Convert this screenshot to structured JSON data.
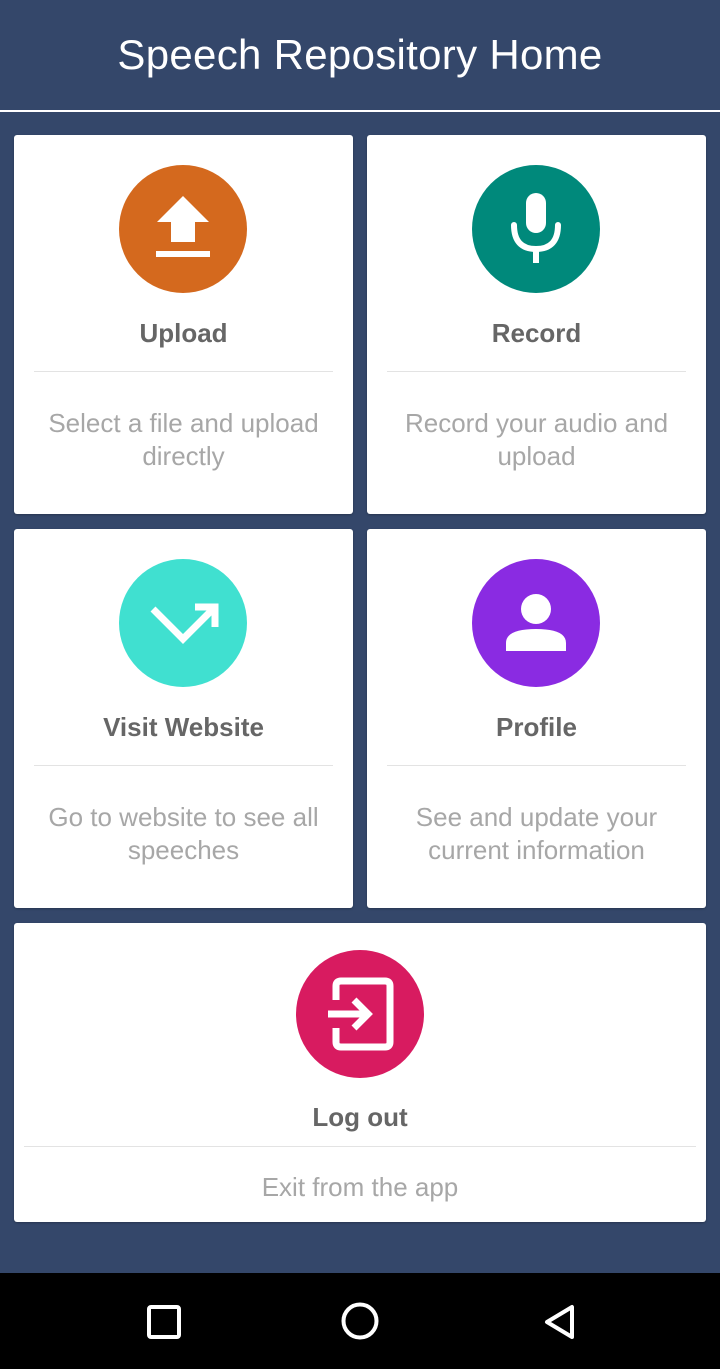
{
  "header": {
    "title": "Speech Repository Home"
  },
  "cards": {
    "upload": {
      "icon": "upload-icon",
      "color": "#d4691e",
      "title": "Upload",
      "description": "Select a file and upload directly"
    },
    "record": {
      "icon": "microphone-icon",
      "color": "#00897b",
      "title": "Record",
      "description": "Record your audio and upload"
    },
    "website": {
      "icon": "trending-arrow-icon",
      "color": "#40e0d0",
      "title": "Visit Website",
      "description": "Go to website to see all speeches"
    },
    "profile": {
      "icon": "person-icon",
      "color": "#8a2be2",
      "title": "Profile",
      "description": "See and update your current information"
    },
    "logout": {
      "icon": "exit-icon",
      "color": "#d81b60",
      "title": "Log out",
      "description": "Exit from the app"
    }
  },
  "navbar": {
    "buttons": [
      "recents-square-icon",
      "home-circle-icon",
      "back-triangle-icon"
    ]
  },
  "colors": {
    "header_bg": "#34476a",
    "card_bg": "#ffffff",
    "navbar_bg": "#000000"
  }
}
